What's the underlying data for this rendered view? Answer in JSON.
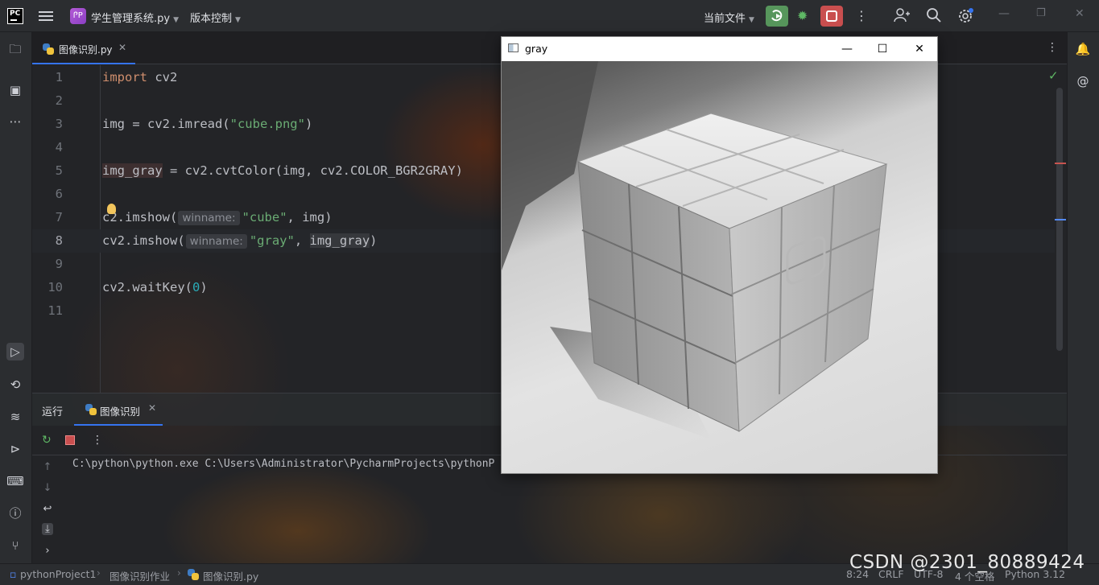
{
  "titlebar": {
    "project_badge": "ᎵP",
    "project_name": "学生管理系统.py",
    "vcs_label": "版本控制",
    "run_config": "当前文件"
  },
  "tab": {
    "file_name": "图像识别.py"
  },
  "editor": {
    "line_numbers": [
      "1",
      "2",
      "3",
      "4",
      "5",
      "6",
      "7",
      "8",
      "9",
      "10",
      "11"
    ],
    "current_line": 8,
    "lines": {
      "l1_kw": "import",
      "l1_rest": " cv2",
      "l3_a": "img = cv2.imread(",
      "l3_str": "\"cube.png\"",
      "l3_b": ")",
      "l5_var": "img_gray",
      "l5_rest": " = cv2.cvtColor(img, cv2.COLOR_BGR2GRAY)",
      "l7_a": "c",
      "l7_b": "2.imshow(",
      "l7_hint": "winname:",
      "l7_str": "\"cube\"",
      "l7_c": ", img)",
      "l8_a": "cv2.imshow(",
      "l8_hint": "winname:",
      "l8_str": "\"gray\"",
      "l8_b": ", ",
      "l8_var": "img_gray",
      "l8_c": ")",
      "l10_a": "cv2.waitKey(",
      "l10_num": "0",
      "l10_b": ")"
    }
  },
  "run_panel": {
    "title": "运行",
    "tab_label": "图像识别",
    "console_output": "C:\\python\\python.exe C:\\Users\\Administrator\\PycharmProjects\\pythonP"
  },
  "cv_window": {
    "title": "gray",
    "minimize": "—",
    "maximize": "☐",
    "close": "✕"
  },
  "statusbar": {
    "breadcrumb": [
      "pythonProject1",
      "图像识别作业",
      "图像识别.py"
    ],
    "position": "8:24",
    "line_sep": "CRLF",
    "encoding": "UTF-8",
    "indent": "4 个空格",
    "interpreter": "Python 3.12"
  },
  "watermark": "CSDN @2301_80889424",
  "colors": {
    "run_button": "#57965c",
    "stop_button": "#c94f4f",
    "accent": "#3574f0"
  }
}
